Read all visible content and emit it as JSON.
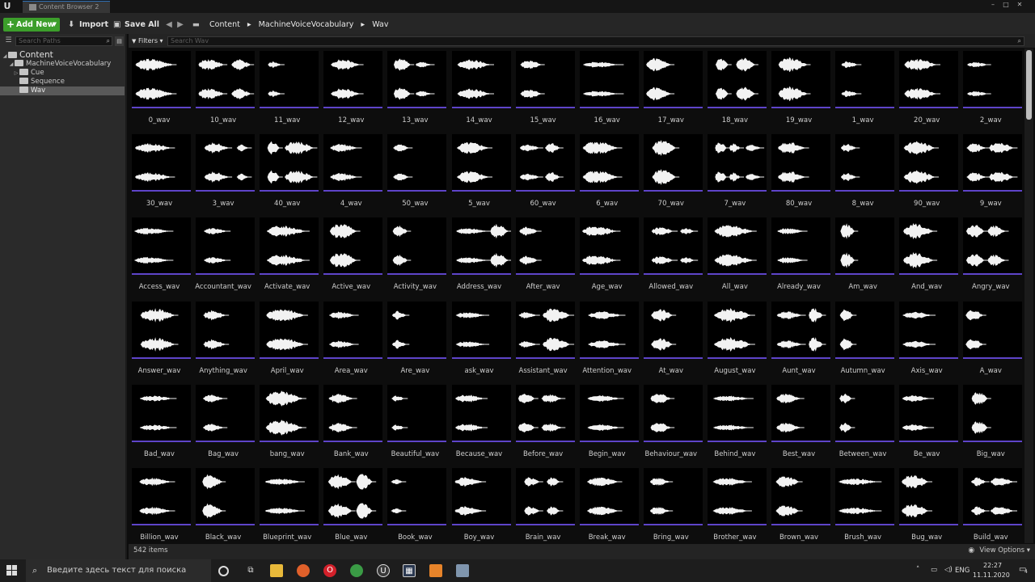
{
  "window": {
    "tab_title": "Content Browser 2",
    "minimize": "–",
    "maximize": "□",
    "close": "✕",
    "logo": "U"
  },
  "toolbar": {
    "add_new": "Add New",
    "import": "Import",
    "save_all": "Save All"
  },
  "breadcrumb": [
    "Content",
    "MachineVoiceVocabulary",
    "Wav"
  ],
  "sidebar": {
    "search_placeholder": "Search Paths",
    "tree": [
      {
        "label": "Content",
        "level": 0,
        "expanded": true
      },
      {
        "label": "MachineVoiceVocabulary",
        "level": 1,
        "expanded": true
      },
      {
        "label": "Cue",
        "level": 2,
        "expanded": false
      },
      {
        "label": "Sequence",
        "level": 2,
        "expanded": false
      },
      {
        "label": "Wav",
        "level": 2,
        "expanded": false,
        "selected": true
      }
    ]
  },
  "filters": {
    "label": "Filters",
    "search_placeholder": "Search Wav"
  },
  "assets": [
    "0_wav",
    "10_wav",
    "11_wav",
    "12_wav",
    "13_wav",
    "14_wav",
    "15_wav",
    "16_wav",
    "17_wav",
    "18_wav",
    "19_wav",
    "1_wav",
    "20_wav",
    "2_wav",
    "30_wav",
    "3_wav",
    "40_wav",
    "4_wav",
    "50_wav",
    "5_wav",
    "60_wav",
    "6_wav",
    "70_wav",
    "7_wav",
    "80_wav",
    "8_wav",
    "90_wav",
    "9_wav",
    "Access_wav",
    "Accountant_wav",
    "Activate_wav",
    "Active_wav",
    "Activity_wav",
    "Address_wav",
    "After_wav",
    "Age_wav",
    "Allowed_wav",
    "All_wav",
    "Already_wav",
    "Am_wav",
    "And_wav",
    "Angry_wav",
    "Answer_wav",
    "Anything_wav",
    "April_wav",
    "Area_wav",
    "Are_wav",
    "ask_wav",
    "Assistant_wav",
    "Attention_wav",
    "At_wav",
    "August_wav",
    "Aunt_wav",
    "Autumn_wav",
    "Axis_wav",
    "A_wav",
    "Bad_wav",
    "Bag_wav",
    "bang_wav",
    "Bank_wav",
    "Beautiful_wav",
    "Because_wav",
    "Before_wav",
    "Begin_wav",
    "Behaviour_wav",
    "Behind_wav",
    "Best_wav",
    "Between_wav",
    "Be_wav",
    "Big_wav",
    "Billion_wav",
    "Black_wav",
    "Blueprint_wav",
    "Blue_wav",
    "Book_wav",
    "Boy_wav",
    "Brain_wav",
    "Break_wav",
    "Bring_wav",
    "Brother_wav",
    "Brown_wav",
    "Brush_wav",
    "Bug_wav",
    "Build_wav"
  ],
  "status": {
    "item_count": "542 items",
    "view_options": "View Options"
  },
  "taskbar": {
    "search_placeholder": "Введите здесь текст для поиска",
    "language": "ENG",
    "time": "22:27",
    "date": "11.11.2020",
    "notification_count": "4"
  },
  "colors": {
    "add_new": "#3c9e2b",
    "thumb_underline": "#5e44c9",
    "selected_folder": "#595959"
  }
}
